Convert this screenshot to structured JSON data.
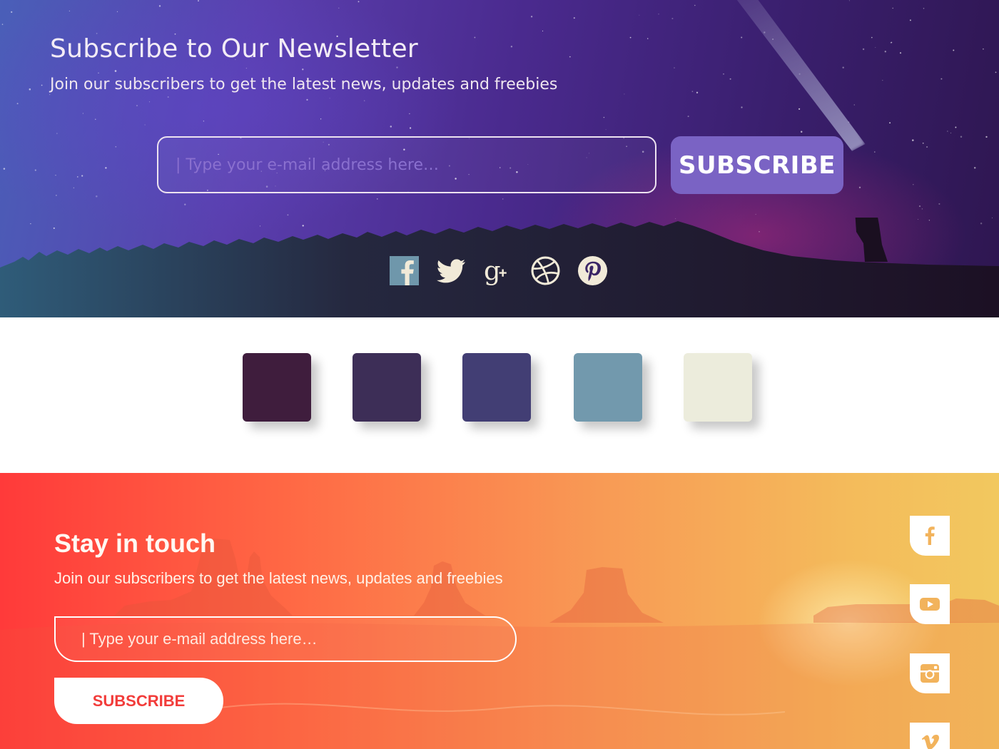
{
  "newsletter_night": {
    "title": "Subscribe to Our Newsletter",
    "subtitle": "Join our subscribers to get the latest news, updates and freebies",
    "email_placeholder": "| Type your e-mail address here…",
    "subscribe_label": "SUBSCRIBE",
    "social_icons": [
      "facebook-icon",
      "twitter-icon",
      "google-plus-icon",
      "dribbble-icon",
      "pinterest-icon"
    ],
    "colors": {
      "button": "#7a63c4",
      "text": "#f3ecf6",
      "icons": "#f1ead8",
      "facebook_icon": "#6f97ab"
    }
  },
  "palette": {
    "swatches": [
      "#3f1d3d",
      "#3d2e57",
      "#423e74",
      "#7299ad",
      "#ececdc"
    ]
  },
  "newsletter_desert": {
    "title": "Stay in touch",
    "subtitle": "Join our subscribers to get the latest news, updates and freebies",
    "email_placeholder": "| Type your e-mail address here…",
    "subscribe_label": "SUBSCRIBE",
    "side_social_icons": [
      "facebook-icon",
      "youtube-icon",
      "instagram-icon",
      "vimeo-icon"
    ],
    "colors": {
      "button_text": "#f23c3a",
      "icons": "#f2b35c",
      "gradient_start": "#ff3a3a",
      "gradient_end": "#f2c85f"
    }
  }
}
